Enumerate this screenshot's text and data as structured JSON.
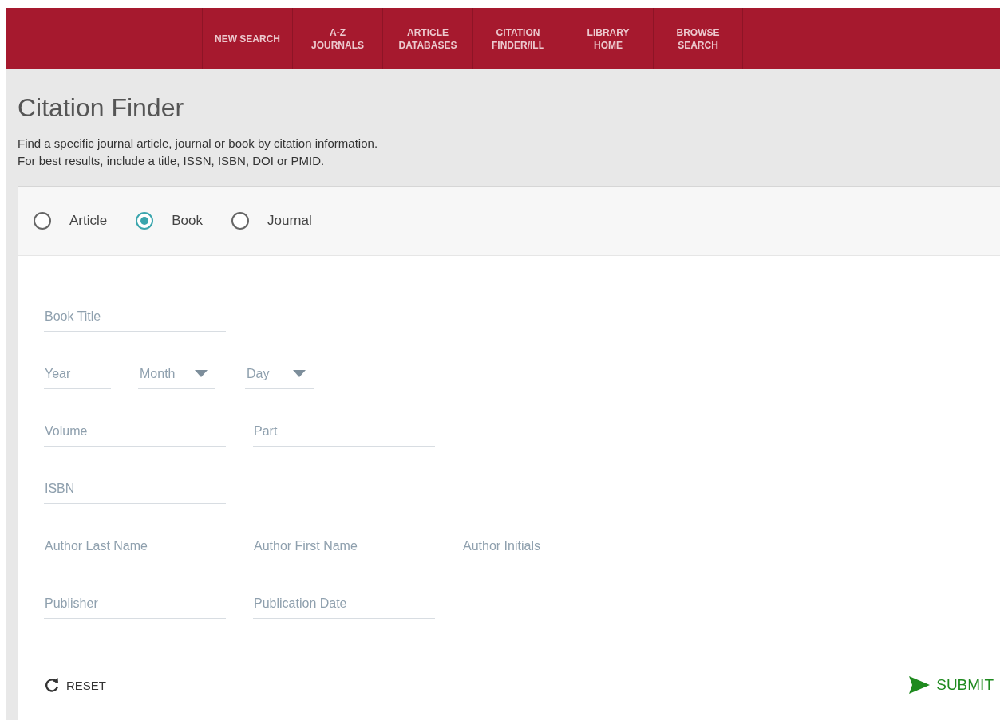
{
  "nav": [
    {
      "label": "NEW SEARCH"
    },
    {
      "label": "A-Z JOURNALS"
    },
    {
      "label": "ARTICLE DATABASES"
    },
    {
      "label": "CITATION FINDER/ILL"
    },
    {
      "label": "LIBRARY HOME"
    },
    {
      "label": "BROWSE SEARCH"
    }
  ],
  "title": "Citation Finder",
  "description": [
    "Find a specific journal article, journal or book by citation information.",
    "For best results, include a title, ISSN, ISBN, DOI or PMID."
  ],
  "types": [
    {
      "label": "Article",
      "selected": false
    },
    {
      "label": "Book",
      "selected": true
    },
    {
      "label": "Journal",
      "selected": false
    }
  ],
  "form_rows": [
    [
      {
        "kind": "text",
        "placeholder": "Book Title"
      }
    ],
    [
      {
        "kind": "short",
        "placeholder": "Year"
      },
      {
        "kind": "select",
        "placeholder": "Month"
      },
      {
        "kind": "select",
        "placeholder": "Day"
      }
    ],
    [
      {
        "kind": "text",
        "placeholder": "Volume"
      },
      {
        "kind": "text",
        "placeholder": "Part"
      }
    ],
    [
      {
        "kind": "text",
        "placeholder": "ISBN"
      }
    ],
    [
      {
        "kind": "text",
        "placeholder": "Author Last Name"
      },
      {
        "kind": "text",
        "placeholder": "Author First Name"
      },
      {
        "kind": "text",
        "placeholder": "Author Initials"
      }
    ],
    [
      {
        "kind": "text",
        "placeholder": "Publisher"
      },
      {
        "kind": "text",
        "placeholder": "Publication Date"
      }
    ]
  ],
  "reset": "RESET",
  "submit": "SUBMIT"
}
